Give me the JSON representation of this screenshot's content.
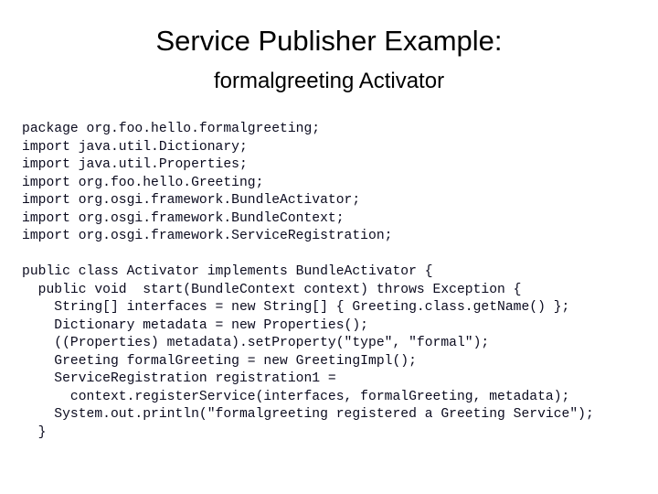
{
  "slide": {
    "title": "Service Publisher Example:",
    "subtitle": "formalgreeting Activator",
    "background_color": "#ffffff",
    "text_color": "#000000",
    "code_color": "#0a0a1e"
  },
  "code": {
    "language": "java",
    "lines": [
      "package org.foo.hello.formalgreeting;",
      "import java.util.Dictionary;",
      "import java.util.Properties;",
      "import org.foo.hello.Greeting;",
      "import org.osgi.framework.BundleActivator;",
      "import org.osgi.framework.BundleContext;",
      "import org.osgi.framework.ServiceRegistration;",
      "",
      "public class Activator implements BundleActivator {",
      "  public void  start(BundleContext context) throws Exception {",
      "    String[] interfaces = new String[] { Greeting.class.getName() };",
      "    Dictionary metadata = new Properties();",
      "    ((Properties) metadata).setProperty(\"type\", \"formal\");",
      "    Greeting formalGreeting = new GreetingImpl();",
      "    ServiceRegistration registration1 =",
      "      context.registerService(interfaces, formalGreeting, metadata);",
      "    System.out.println(\"formalgreeting registered a Greeting Service\");",
      "  }"
    ]
  }
}
